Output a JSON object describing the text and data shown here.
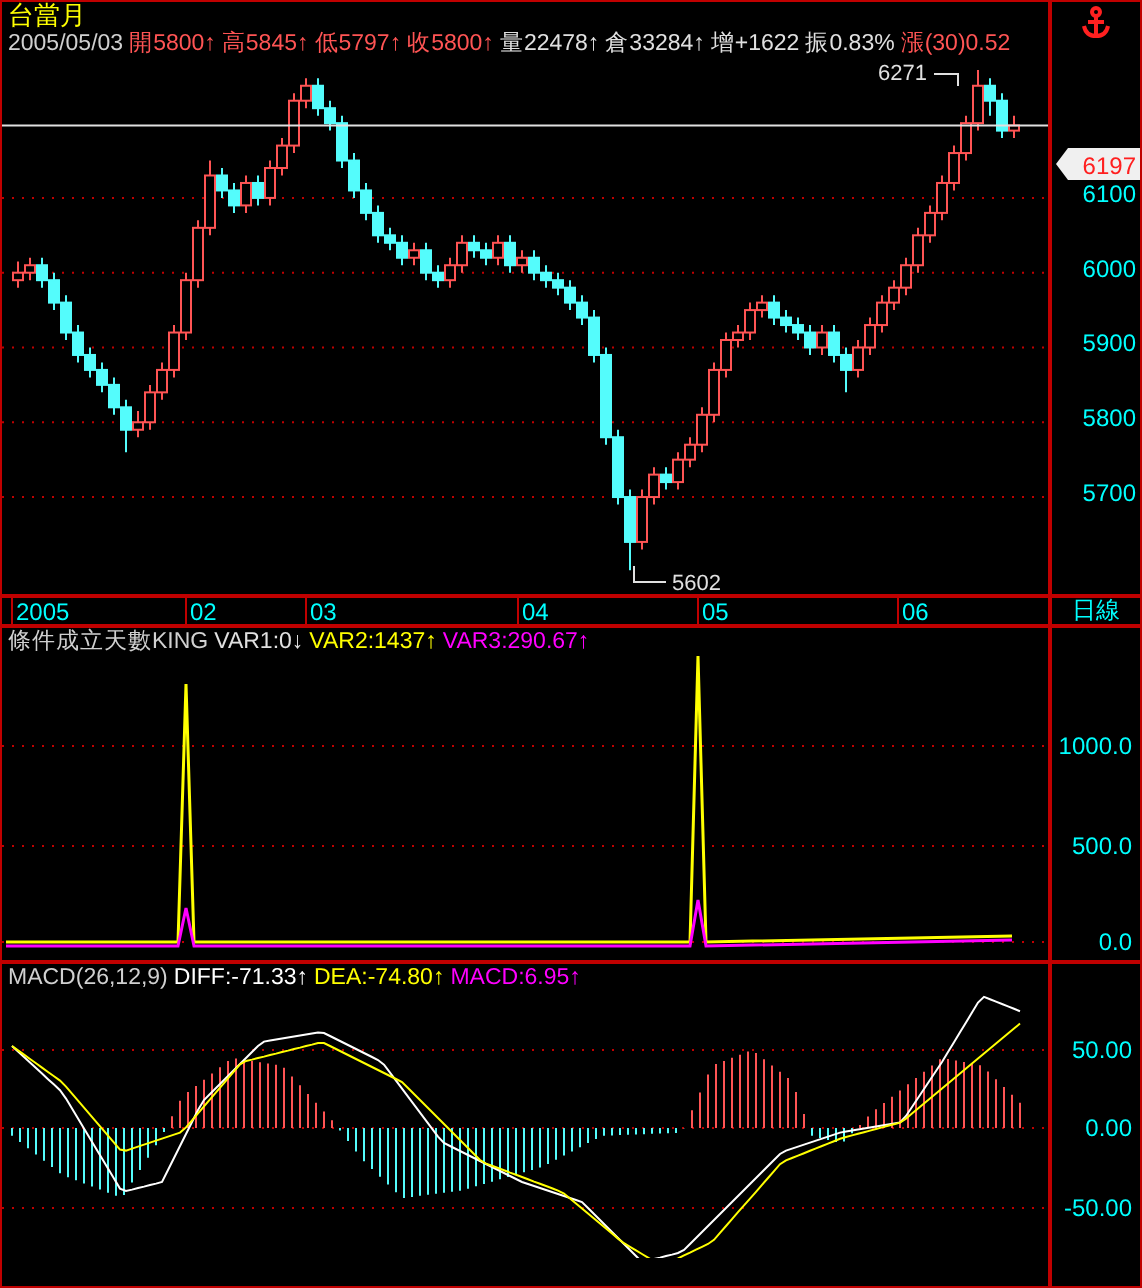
{
  "header": {
    "title": "台當月",
    "date": "2005/05/03",
    "quotes": [
      {
        "text": "開5800↑",
        "color": "#ff5454"
      },
      {
        "text": "高5845↑",
        "color": "#ff5454"
      },
      {
        "text": "低5797↑",
        "color": "#ff5454"
      },
      {
        "text": "收5800↑",
        "color": "#ff5454"
      },
      {
        "text": "量22478↑",
        "color": "#e0e0e0"
      },
      {
        "text": "倉33284↑",
        "color": "#e0e0e0"
      },
      {
        "text": "增+1622",
        "color": "#e0e0e0"
      },
      {
        "text": "振0.83%",
        "color": "#e0e0e0"
      },
      {
        "text": "漲(30)0.52",
        "color": "#ff5454"
      }
    ]
  },
  "price_chart": {
    "high_label": "6271",
    "low_label": "5602",
    "chart_data": {
      "type": "candlestick",
      "ylim": [
        5565,
        6362
      ],
      "grid": true,
      "ref_lines": [
        {
          "value": 6197,
          "label": "6197",
          "axis": "y"
        }
      ],
      "yticks": [
        {
          "value": 6100,
          "label": "6100"
        },
        {
          "value": 6000,
          "label": "6000"
        },
        {
          "value": 5900,
          "label": "5900"
        },
        {
          "value": 5800,
          "label": "5800"
        },
        {
          "value": 5700,
          "label": "5700"
        }
      ],
      "ohlc": [
        [
          5990,
          6015,
          5980,
          6000
        ],
        [
          6000,
          6020,
          5990,
          6010
        ],
        [
          6010,
          6020,
          5980,
          5990
        ],
        [
          5990,
          6000,
          5950,
          5960
        ],
        [
          5960,
          5970,
          5910,
          5920
        ],
        [
          5920,
          5930,
          5880,
          5890
        ],
        [
          5890,
          5900,
          5860,
          5870
        ],
        [
          5870,
          5880,
          5840,
          5850
        ],
        [
          5850,
          5860,
          5810,
          5820
        ],
        [
          5820,
          5830,
          5760,
          5790
        ],
        [
          5790,
          5815,
          5780,
          5800
        ],
        [
          5800,
          5850,
          5790,
          5840
        ],
        [
          5840,
          5880,
          5830,
          5870
        ],
        [
          5870,
          5930,
          5860,
          5920
        ],
        [
          5920,
          6000,
          5910,
          5990
        ],
        [
          5990,
          6070,
          5980,
          6060
        ],
        [
          6060,
          6150,
          6050,
          6130
        ],
        [
          6130,
          6140,
          6100,
          6110
        ],
        [
          6110,
          6120,
          6080,
          6090
        ],
        [
          6090,
          6130,
          6080,
          6120
        ],
        [
          6120,
          6130,
          6090,
          6100
        ],
        [
          6100,
          6150,
          6090,
          6140
        ],
        [
          6140,
          6180,
          6130,
          6170
        ],
        [
          6170,
          6240,
          6160,
          6230
        ],
        [
          6230,
          6260,
          6220,
          6250
        ],
        [
          6250,
          6260,
          6210,
          6220
        ],
        [
          6220,
          6230,
          6190,
          6200
        ],
        [
          6200,
          6210,
          6140,
          6150
        ],
        [
          6150,
          6160,
          6100,
          6110
        ],
        [
          6110,
          6120,
          6070,
          6080
        ],
        [
          6080,
          6090,
          6040,
          6050
        ],
        [
          6050,
          6060,
          6030,
          6040
        ],
        [
          6040,
          6050,
          6010,
          6020
        ],
        [
          6020,
          6040,
          6010,
          6030
        ],
        [
          6030,
          6040,
          5990,
          6000
        ],
        [
          6000,
          6010,
          5980,
          5990
        ],
        [
          5990,
          6020,
          5980,
          6010
        ],
        [
          6010,
          6050,
          6000,
          6040
        ],
        [
          6040,
          6050,
          6020,
          6030
        ],
        [
          6030,
          6040,
          6010,
          6020
        ],
        [
          6020,
          6050,
          6010,
          6040
        ],
        [
          6040,
          6050,
          6000,
          6010
        ],
        [
          6010,
          6030,
          6000,
          6020
        ],
        [
          6020,
          6030,
          5990,
          6000
        ],
        [
          6000,
          6010,
          5980,
          5990
        ],
        [
          5990,
          6000,
          5970,
          5980
        ],
        [
          5980,
          5990,
          5950,
          5960
        ],
        [
          5960,
          5970,
          5930,
          5940
        ],
        [
          5940,
          5950,
          5880,
          5890
        ],
        [
          5890,
          5900,
          5770,
          5780
        ],
        [
          5780,
          5790,
          5690,
          5700
        ],
        [
          5700,
          5710,
          5602,
          5640
        ],
        [
          5640,
          5710,
          5630,
          5700
        ],
        [
          5700,
          5740,
          5690,
          5730
        ],
        [
          5730,
          5740,
          5710,
          5720
        ],
        [
          5720,
          5760,
          5710,
          5750
        ],
        [
          5750,
          5780,
          5740,
          5770
        ],
        [
          5770,
          5820,
          5760,
          5810
        ],
        [
          5810,
          5880,
          5800,
          5870
        ],
        [
          5870,
          5920,
          5860,
          5910
        ],
        [
          5910,
          5930,
          5900,
          5920
        ],
        [
          5920,
          5960,
          5910,
          5950
        ],
        [
          5950,
          5970,
          5940,
          5960
        ],
        [
          5960,
          5970,
          5930,
          5940
        ],
        [
          5940,
          5950,
          5920,
          5930
        ],
        [
          5930,
          5940,
          5910,
          5920
        ],
        [
          5920,
          5930,
          5890,
          5900
        ],
        [
          5900,
          5930,
          5890,
          5920
        ],
        [
          5920,
          5930,
          5880,
          5890
        ],
        [
          5890,
          5900,
          5840,
          5870
        ],
        [
          5870,
          5910,
          5860,
          5900
        ],
        [
          5900,
          5940,
          5890,
          5930
        ],
        [
          5930,
          5970,
          5920,
          5960
        ],
        [
          5960,
          5990,
          5950,
          5980
        ],
        [
          5980,
          6020,
          5970,
          6010
        ],
        [
          6010,
          6060,
          6000,
          6050
        ],
        [
          6050,
          6090,
          6040,
          6080
        ],
        [
          6080,
          6130,
          6070,
          6120
        ],
        [
          6120,
          6170,
          6110,
          6160
        ],
        [
          6160,
          6210,
          6150,
          6200
        ],
        [
          6200,
          6271,
          6190,
          6250
        ],
        [
          6250,
          6260,
          6210,
          6230
        ],
        [
          6230,
          6240,
          6180,
          6190
        ],
        [
          6190,
          6210,
          6180,
          6197
        ]
      ]
    }
  },
  "x_axis": {
    "labels": [
      "2005",
      "02",
      "03",
      "04",
      "05",
      "06"
    ],
    "period": "日線"
  },
  "indicator_panel": {
    "title": "條件成立天數KING",
    "values": [
      {
        "text": "VAR1:0↓",
        "color": "#e0e0e0"
      },
      {
        "text": "VAR2:1437↑",
        "color": "#ffff00"
      },
      {
        "text": "VAR3:290.67↑",
        "color": "#ff00ff"
      }
    ],
    "yticks": [
      "1000.0",
      "500.0",
      "0.0"
    ]
  },
  "macd_panel": {
    "title": "MACD(26,12,9)",
    "values": [
      {
        "text": "DIFF:-71.33↑",
        "color": "#ffffff"
      },
      {
        "text": "DEA:-74.80↑",
        "color": "#ffff00"
      },
      {
        "text": "MACD:6.95↑",
        "color": "#ff00ff"
      }
    ],
    "yticks": [
      "50.00",
      "0.00",
      "-50.00"
    ]
  }
}
